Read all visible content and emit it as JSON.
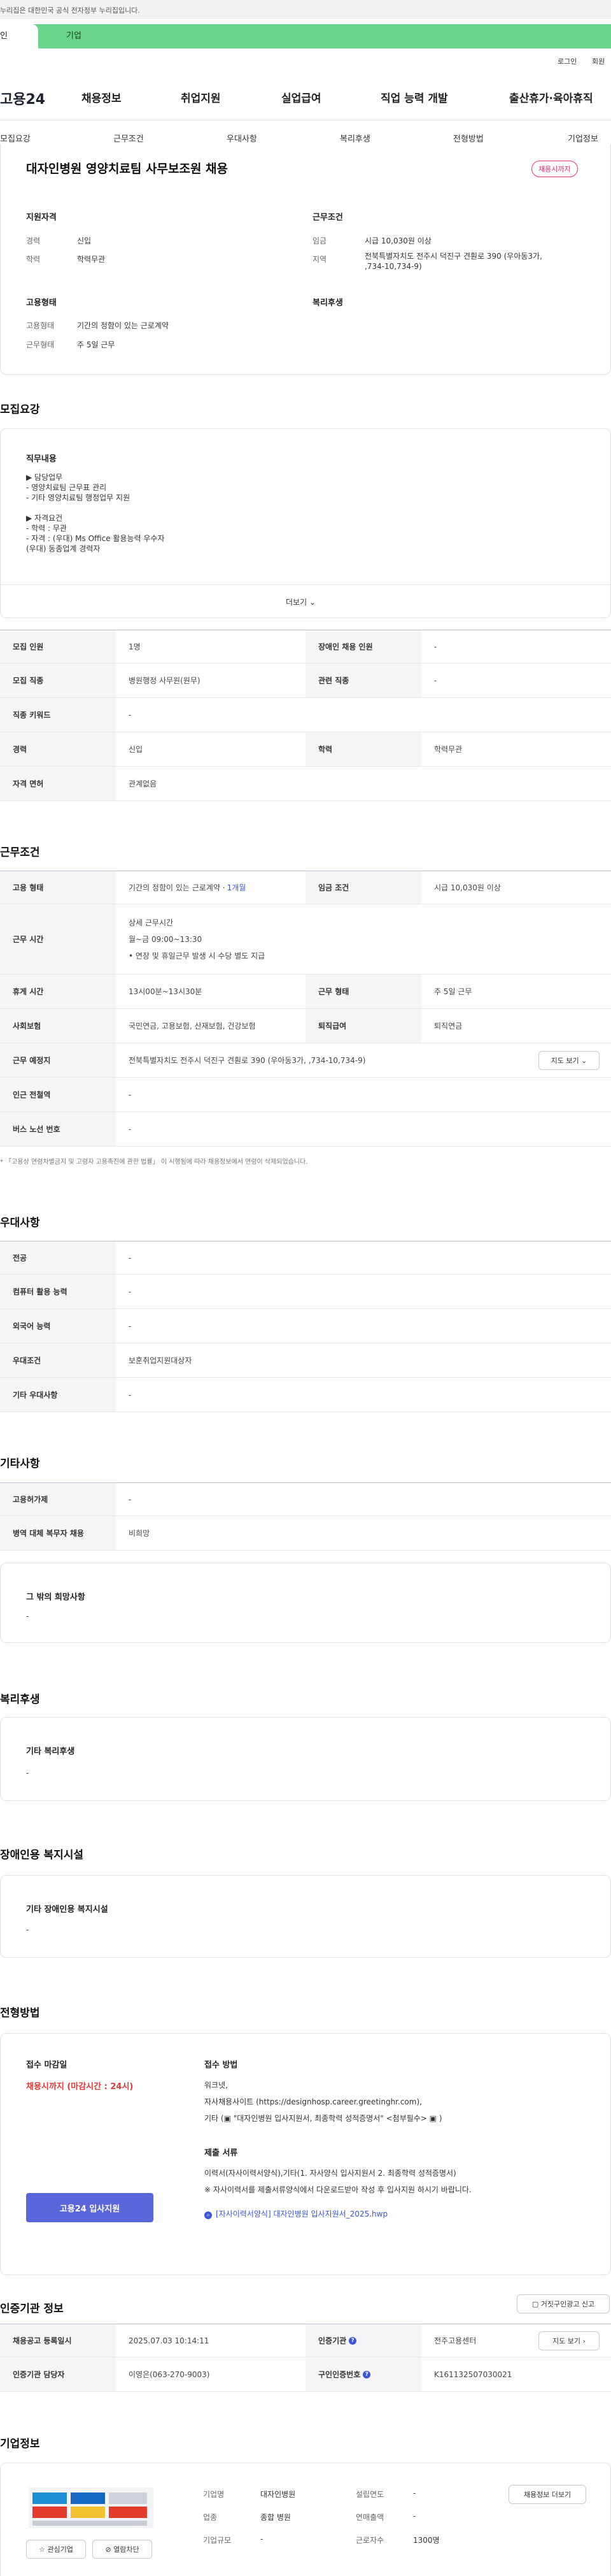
{
  "gov_bar": {
    "text": "누리집은 대한민국 공식 전자정부 누리집입니다."
  },
  "mode_tabs": [
    "인",
    "기업"
  ],
  "top_links": {
    "login": "로그인",
    "join": "회원"
  },
  "logo": "고용24",
  "gnb": [
    "채용정보",
    "취업지원",
    "실업급여",
    "직업 능력 개발",
    "출산휴가·육아휴직"
  ],
  "subnav": [
    "모집요강",
    "근무조건",
    "우대사항",
    "복리후생",
    "전형방법",
    "기업정보"
  ],
  "summary": {
    "title": "대자인병원 영양치료팀 사무보조원 채용",
    "badge": "채용시까지",
    "qual_title": "지원자격",
    "cond_title": "근무조건",
    "career_label": "경력",
    "career_value": "신입",
    "edu_label": "학력",
    "edu_value": "학력무관",
    "wage_label": "임금",
    "wage_value": "시급 10,030원 이상",
    "region_label": "지역",
    "region_value": "전북특별자치도 전주시 덕진구 견훤로 390 (우아동3가,\n,734-10,734-9)",
    "emp_title": "고용형태",
    "welfare_title": "복리후생",
    "emp_type_label": "고용형태",
    "emp_type_value": "기간의 정함이 있는 근로계약",
    "work_form_label": "근무형태",
    "work_form_value": "주 5일 근무"
  },
  "recruit": {
    "title": "모집요강",
    "content_title": "직무내용",
    "content": "▶ 담당업무\n- 영양치료팀 근무표 관리\n- 기타 영양치료팀 행정업무 지원\n\n▶ 자격요건\n- 학력 : 무관\n- 자격 : (우대) Ms Office 활용능력 우수자\n        (우대) 동종업계 경력자",
    "more": "더보기",
    "rows": [
      {
        "h1": "모집 인원",
        "v1": "1명",
        "h2": "장애인 채용 인원",
        "v2": "-"
      },
      {
        "h1": "모집 직종",
        "v1": "병원행정 사무원(원무)",
        "h2": "관련 직종",
        "v2": "-"
      },
      {
        "h1": "직종 키워드",
        "v1": "-"
      },
      {
        "h1": "경력",
        "v1": "신입",
        "h2": "학력",
        "v2": "학력무관"
      },
      {
        "h1": "자격 면허",
        "v1": "관계없음"
      }
    ]
  },
  "work": {
    "title": "근무조건",
    "emp_h": "고용 형태",
    "emp_v": "기간의 정함이 있는 근로계약 · ",
    "emp_v_blue": "1개월",
    "wage_h": "임금 조건",
    "wage_v": "시급 10,030원 이상",
    "time_h": "근무 시간",
    "time_title": "상세 근무시간",
    "time_1": "월~금 09:00~13:30",
    "time_2": "• 연장 및 휴일근무 발생 시 수당 별도 지급",
    "rest_h": "휴게 시간",
    "rest_v": "13시00분~13시30분",
    "form_h": "근무 형태",
    "form_v": "주 5일 근무",
    "ins_h": "사회보험",
    "ins_v": "국민연금, 고용보험, 산재보험, 건강보험",
    "ret_h": "퇴직급여",
    "ret_v": "퇴직연금",
    "place_h": "근무 예정지",
    "place_v": "전북특별자치도 전주시 덕진구 견훤로 390 (우아동3가, ,734-10,734-9)",
    "map_btn": "지도 보기",
    "subway_h": "인근 전철역",
    "subway_v": "-",
    "bus_h": "버스 노선 번호",
    "bus_v": "-",
    "note": "* 「고용상 연령차별금지 및 고령자 고용촉진에 관한 법률」 이 시행됨에 따라 채용정보에서 연령이 삭제되었습니다."
  },
  "pref": {
    "title": "우대사항",
    "rows": [
      {
        "h": "전공",
        "v": "-"
      },
      {
        "h": "컴퓨터 활용 능력",
        "v": "-"
      },
      {
        "h": "외국어 능력",
        "v": "-"
      },
      {
        "h": "우대조건",
        "v": "보훈취업지원대상자"
      },
      {
        "h": "기타 우대사항",
        "v": "-"
      }
    ]
  },
  "etc": {
    "title": "기타사항",
    "rows": [
      {
        "h": "고용허가제",
        "v": "-"
      },
      {
        "h": "병역 대체 복무자 채용",
        "v": "비희망"
      }
    ],
    "hope_title": "그 밖의 희망사항",
    "hope_value": "-"
  },
  "welfare": {
    "title": "복리후생",
    "box_title": "기타 복리후생",
    "box_value": "-"
  },
  "disability": {
    "title": "장애인용 복지시설",
    "box_title": "기타 장애인용 복지시설",
    "box_value": "-"
  },
  "selection": {
    "title": "전형방법",
    "deadline_label": "접수 마감일",
    "deadline_value": "채용시까지 (마감시간 : 24시)",
    "method_label": "접수 방법",
    "method_value": "워크넷,\n자사채용사이트 (https://designhosp.career.greetinghr.com),\n기타 (▣ \"대자인병원 입사지원서, 최종학력 성적증명서\" <첨부필수> ▣ )",
    "docs_label": "제출 서류",
    "docs_value": "이력서(자사이력서양식),기타(1. 자사양식 입사지원서 2. 최종학력 성적증명서)\n※ 자사이력서를 제출서류양식에서 다운로드받아 작성 후 입사지원 하시기 바랍니다.",
    "file_link": "[자사이력서양식] 대자인병원 입사지원서_2025.hwp",
    "apply_btn": "고용24 입사지원"
  },
  "cert": {
    "title": "인증기관 정보",
    "report_btn": "거짓구인광고 신고",
    "row1": {
      "h1": "채용공고 등록일시",
      "v1": "2025.07.03 10:14:11",
      "h2": "인증기관",
      "v2": "전주고용센터",
      "btn": "지도 보기"
    },
    "row2": {
      "h1": "인증기관 담당자",
      "v1": "이영은(063-270-9003)",
      "h2": "구인인증번호",
      "v2": "K161132507030021"
    }
  },
  "company": {
    "title": "기업정보",
    "name_label": "기업명",
    "name_value": "대자인병원",
    "est_label": "설립연도",
    "est_value": "-",
    "industry_label": "업종",
    "industry_value": "종합 병원",
    "sales_label": "연매출액",
    "sales_value": "-",
    "size_label": "기업규모",
    "size_value": "-",
    "emp_label": "근로자수",
    "emp_value": "1300명",
    "fav_btn": "관심기업",
    "block_btn": "열람차단",
    "info_btn": "채용정보 더보기"
  }
}
